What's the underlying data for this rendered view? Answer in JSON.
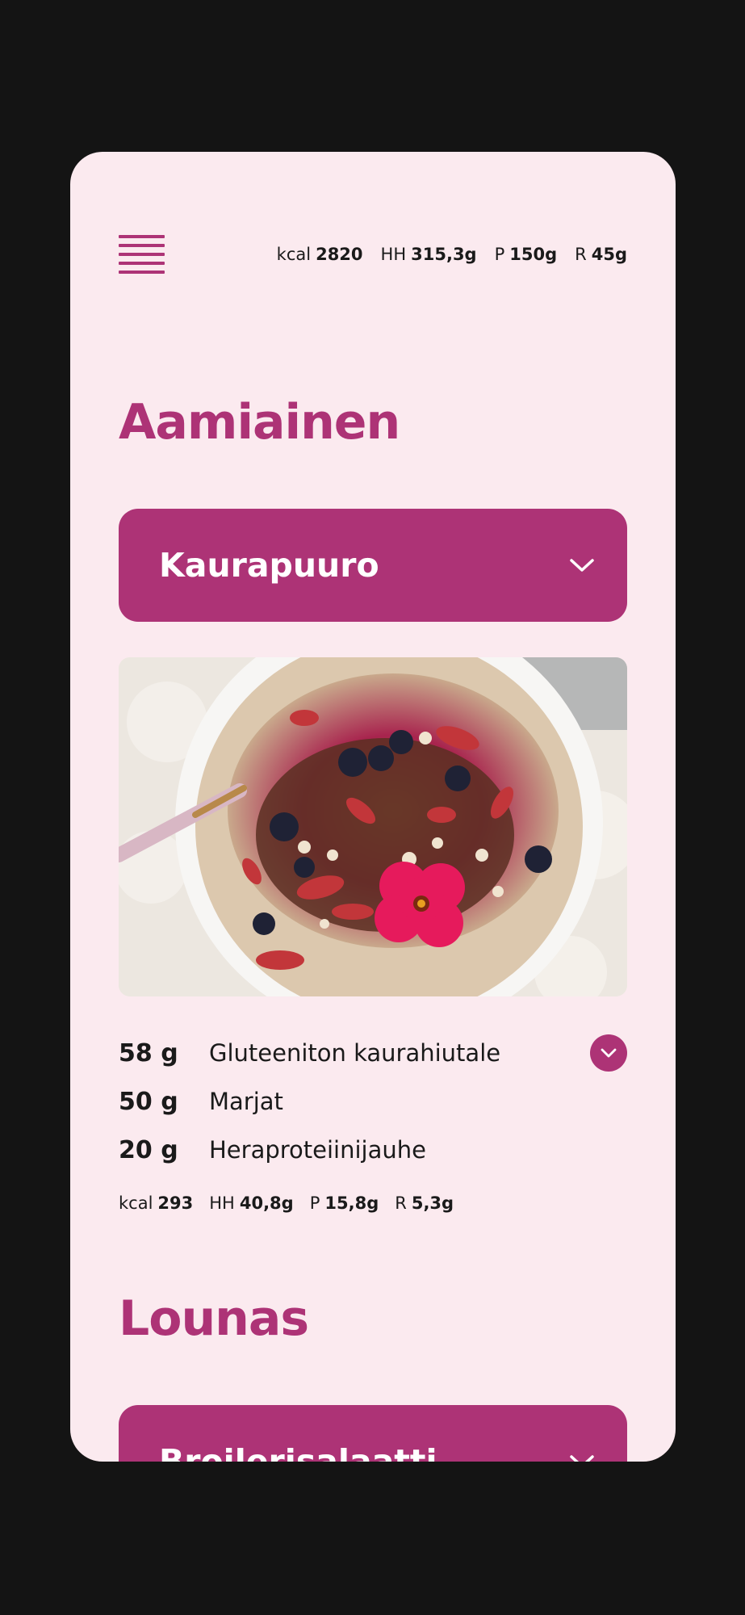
{
  "colors": {
    "accent": "#ad3376",
    "background": "#fbeaef",
    "frame": "#141414",
    "text": "#1a1a1a"
  },
  "header": {
    "menu_icon": "hamburger-menu-icon",
    "totals": [
      {
        "label": "kcal",
        "value": "2820"
      },
      {
        "label": "HH",
        "value": "315,3g"
      },
      {
        "label": "P",
        "value": "150g"
      },
      {
        "label": "R",
        "value": "45g"
      }
    ]
  },
  "sections": [
    {
      "title": "Aamiainen",
      "meal": {
        "name": "Kaurapuuro",
        "dropdown_icon": "chevron-down-icon",
        "image_description_icon": "food-photo",
        "ingredients": [
          {
            "amount": "58 g",
            "name": "Gluteeniton kaurahiutale"
          },
          {
            "amount": "50 g",
            "name": "Marjat"
          },
          {
            "amount": "20 g",
            "name": "Heraproteiinijauhe"
          }
        ],
        "totals": [
          {
            "label": "kcal",
            "value": "293"
          },
          {
            "label": "HH",
            "value": "40,8g"
          },
          {
            "label": "P",
            "value": "15,8g"
          },
          {
            "label": "R",
            "value": "5,3g"
          }
        ]
      }
    },
    {
      "title": "Lounas",
      "meal": {
        "name": "Broilerisalaatti",
        "dropdown_icon": "chevron-down-icon"
      }
    }
  ]
}
